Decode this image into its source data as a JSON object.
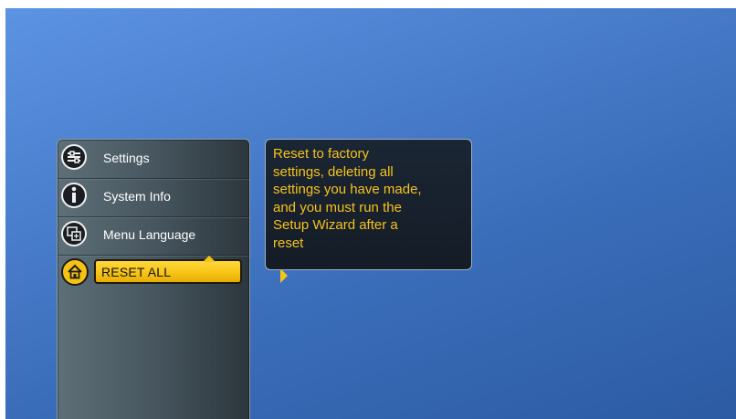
{
  "menu": {
    "items": [
      {
        "label": "Settings",
        "icon": "settings-sliders-icon"
      },
      {
        "label": "System Info",
        "icon": "info-icon"
      },
      {
        "label": "Menu Language",
        "icon": "language-icon"
      },
      {
        "label": "RESET ALL",
        "icon": "home-icon",
        "selected": true
      }
    ]
  },
  "info": {
    "lines": [
      "Reset to factory",
      "settings, deleting all",
      "settings you have made,",
      "and you must run the",
      "Setup Wizard after a",
      "reset"
    ]
  },
  "colors": {
    "highlight": "#f7c515",
    "info_text": "#f7c21b",
    "background_blue": "#3a6db9"
  }
}
